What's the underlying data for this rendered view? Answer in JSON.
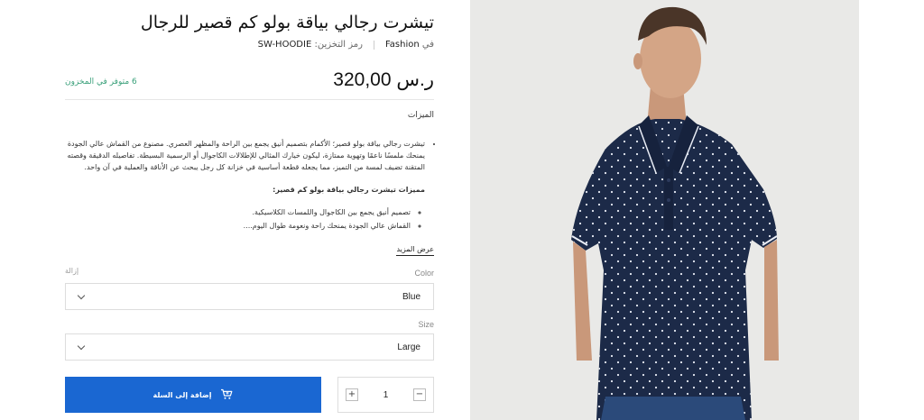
{
  "product": {
    "title": "تيشرت رجالي بياقة بولو كم قصير للرجال",
    "brand_prefix": "في",
    "brand": "Fashion",
    "sku_label": "رمز التخزين:",
    "sku": "SW-HOODIE",
    "price": "320,00 ر.س",
    "stock": "6 متوفر في المخزون"
  },
  "description": {
    "features_label": "الميزات",
    "paragraph": "تيشرت رجالي بياقة بولو قصير؛ الأكمام بتصميم أنيق يجمع بين الراحة والمظهر العصري. مصنوع من القماش عالي الجودة يمنحك ملمسًا ناعمًا وتهوية ممتازة، ليكون خيارك المثالي للإطلالات الكاجوال أو الرسمية البسيطة. تفاصيله الدقيقة وقصته المتقنة تضيف لمسة من التميز، مما يجعله قطعة أساسية في خزانة كل رجل يبحث عن الأناقة والعملية في آن واحد.",
    "subheading": "مميزات تيشرت رجالي بياقة بولو كم قصير:",
    "bullets": [
      "تصميم أنيق يجمع بين الكاجوال واللمسات الكلاسيكية.",
      "القماش عالي الجودة يمنحك راحة ونعومة طوال اليوم...."
    ],
    "show_more": "عرض المزيد"
  },
  "options": {
    "clear": "إزالة",
    "color_label": "Color",
    "color_value": "Blue",
    "size_label": "Size",
    "size_value": "Large"
  },
  "cart": {
    "button_label": "إضافة إلى السلة",
    "quantity": "1",
    "plus": "+",
    "minus": "−"
  },
  "colors": {
    "accent": "#1a67d2",
    "stock": "#3aa07a",
    "shirt": "#1c2a48"
  }
}
